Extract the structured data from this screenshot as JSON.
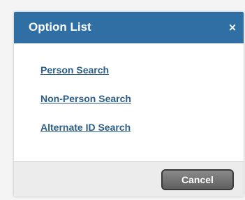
{
  "dialog": {
    "title": "Option List",
    "close_icon": "close-icon",
    "close_glyph": "×",
    "options": [
      {
        "label": "Person Search"
      },
      {
        "label": "Non-Person Search"
      },
      {
        "label": "Alternate ID Search"
      }
    ],
    "cancel_label": "Cancel"
  },
  "colors": {
    "header": "#2f6fa3",
    "link": "#2b5f8a",
    "footer": "#ececec",
    "cancel_button": "#6f6f6f"
  }
}
